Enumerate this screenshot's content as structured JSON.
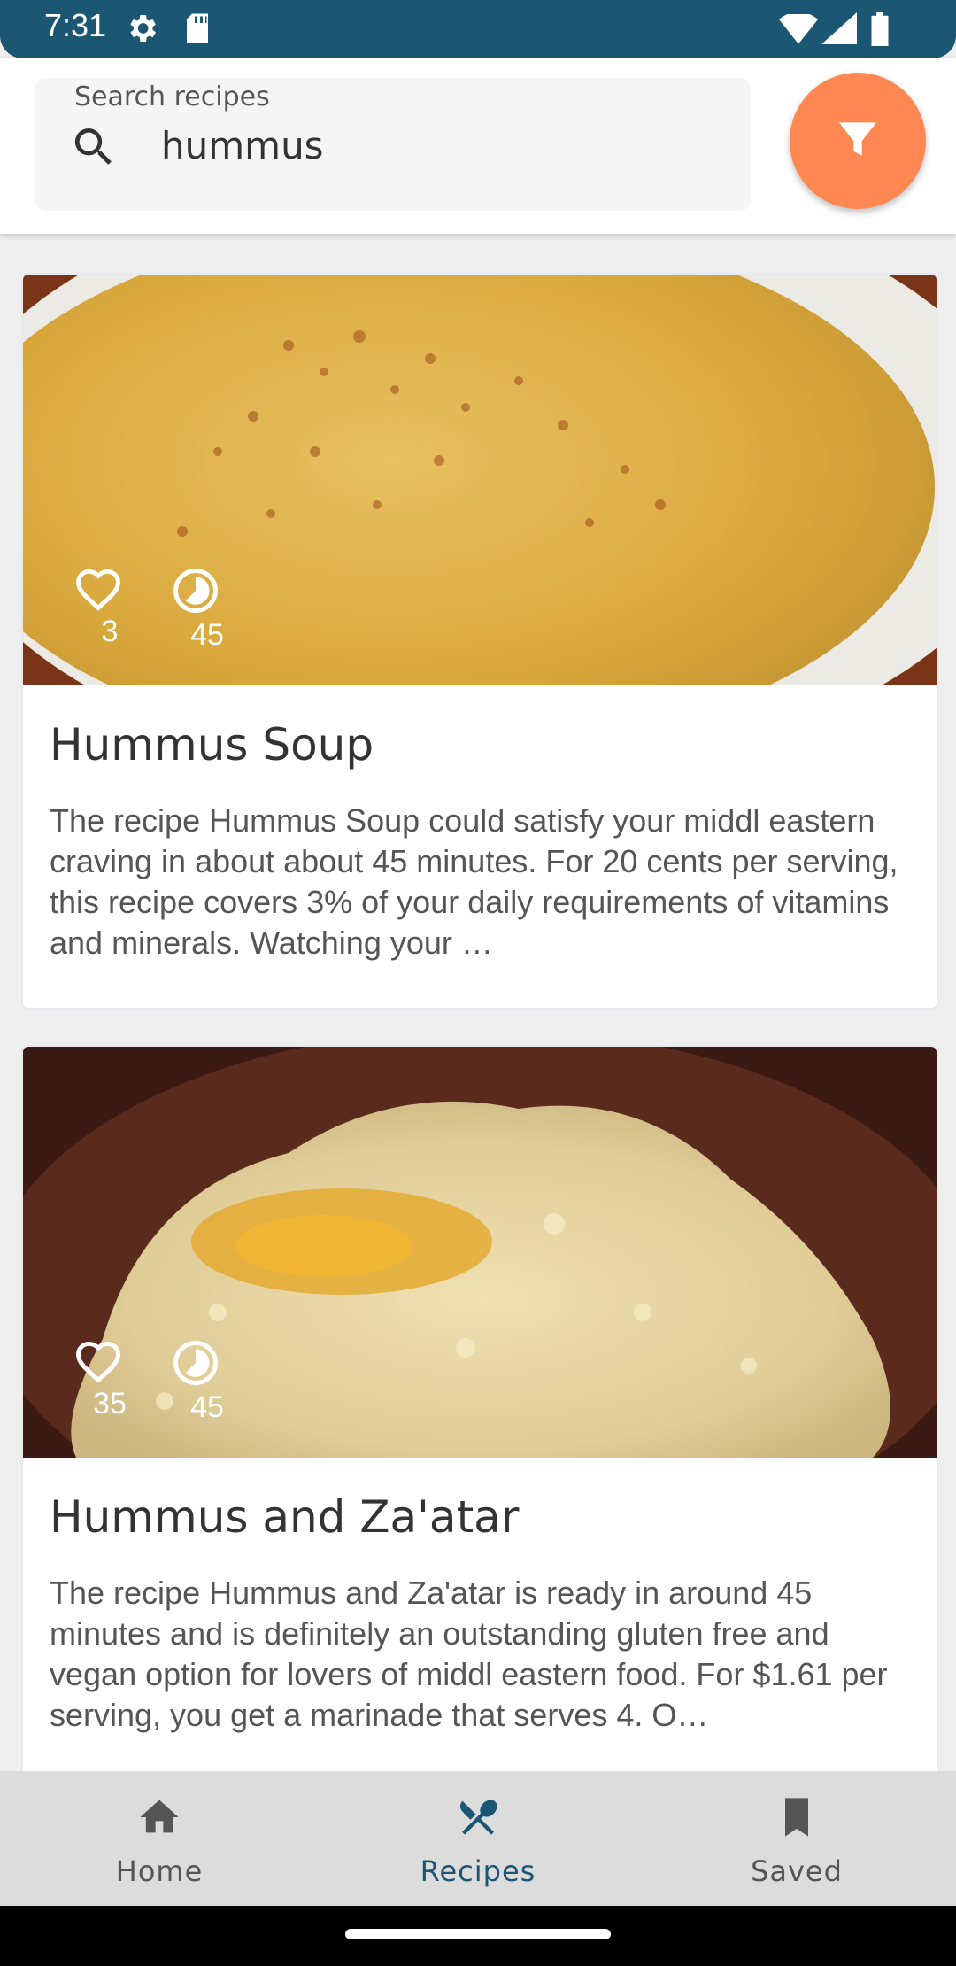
{
  "status_bar": {
    "time": "7:31",
    "icons": [
      "gear-icon",
      "sd-card-icon",
      "wifi-icon",
      "signal-icon",
      "battery-icon"
    ]
  },
  "search": {
    "label": "Search recipes",
    "value": "hummus",
    "filter_icon": "filter-icon"
  },
  "recipes": [
    {
      "likes": "3",
      "minutes": "45",
      "title": "Hummus Soup",
      "description": "The recipe Hummus Soup could satisfy your middl eastern craving in about about 45 minutes. For 20 cents per serving, this recipe covers 3% of your daily requirements of vitamins and minerals. Watching your …"
    },
    {
      "likes": "35",
      "minutes": "45",
      "title": "Hummus and Za'atar",
      "description": "The recipe Hummus and Za'atar is ready in around 45 minutes and is definitely an outstanding gluten free and vegan option for lovers of middl eastern food. For $1.61 per serving, you get a marinade that serves 4. O…"
    }
  ],
  "bottom_nav": {
    "items": [
      {
        "label": "Home",
        "icon": "home-icon",
        "active": false
      },
      {
        "label": "Recipes",
        "icon": "fork-knife-icon",
        "active": true
      },
      {
        "label": "Saved",
        "icon": "bookmark-icon",
        "active": false
      }
    ]
  },
  "colors": {
    "primary": "#1b5772",
    "accent": "#fe8752",
    "nav_background": "#dcdcdc"
  }
}
